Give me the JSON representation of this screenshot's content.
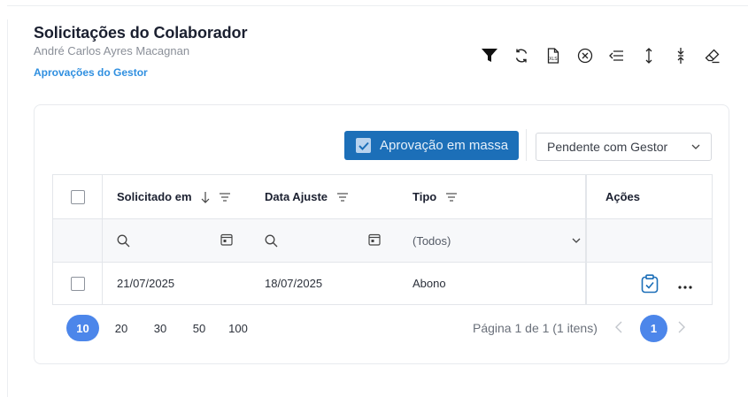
{
  "header": {
    "title": "Solicitações do Colaborador",
    "subtitle": "André Carlos Ayres Macagnan",
    "breadcrumb_link": "Aprovações do Gestor"
  },
  "toolbar": {
    "icons": [
      "filter-icon",
      "refresh-icon",
      "export-xls-icon",
      "clear-circle-icon",
      "collapse-left-icon",
      "expand-vertical-icon",
      "collapse-vertical-icon",
      "eraser-icon"
    ]
  },
  "actions": {
    "mass_approval_label": "Aprovação em massa",
    "status_filter_value": "Pendente com Gestor"
  },
  "table": {
    "columns": {
      "solicitado_em": "Solicitado em",
      "data_ajuste": "Data Ajuste",
      "tipo": "Tipo",
      "acoes": "Ações"
    },
    "filters": {
      "tipo_value": "(Todos)"
    },
    "rows": [
      {
        "solicitado_em": "21/07/2025",
        "data_ajuste": "18/07/2025",
        "tipo": "Abono"
      }
    ]
  },
  "pagination": {
    "page_sizes": [
      "10",
      "20",
      "30",
      "50",
      "100"
    ],
    "active_page_size": "10",
    "info": "Página 1 de 1 (1 itens)",
    "current_page": "1"
  },
  "colors": {
    "accent": "#1c6fb8",
    "link": "#2f8fe0",
    "pager_active": "#4c86ea"
  }
}
